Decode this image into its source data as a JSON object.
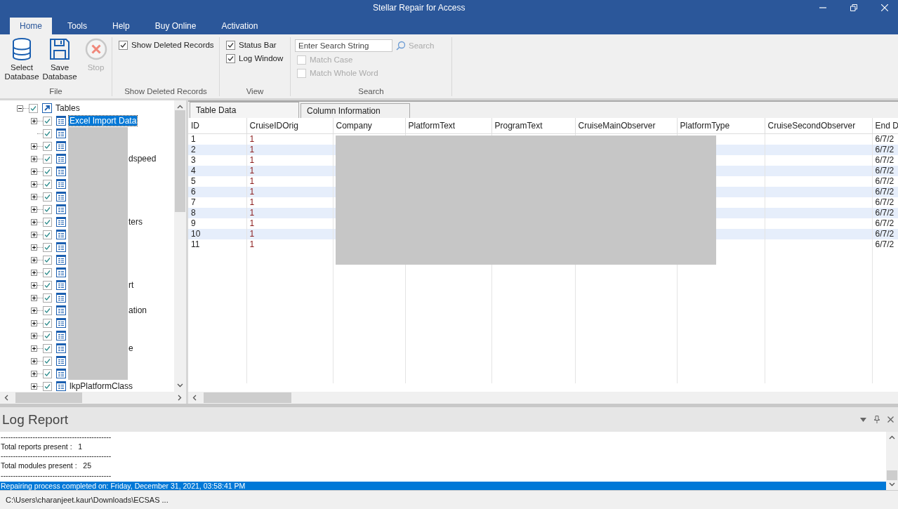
{
  "window": {
    "title": "Stellar Repair for Access"
  },
  "ribbon_tabs": [
    {
      "label": "Home",
      "selected": true
    },
    {
      "label": "Tools",
      "selected": false
    },
    {
      "label": "Help",
      "selected": false
    },
    {
      "label": "Buy Online",
      "selected": false
    },
    {
      "label": "Activation",
      "selected": false
    }
  ],
  "ribbon": {
    "file": {
      "title": "File",
      "buttons": [
        {
          "label": "Select Database",
          "disabled": false
        },
        {
          "label": "Save Database",
          "disabled": false
        },
        {
          "label": "Stop",
          "disabled": true
        }
      ]
    },
    "deleted": {
      "title": "Show Deleted Records",
      "checkboxes": [
        {
          "label": "Show Deleted Records",
          "checked": true,
          "disabled": false
        }
      ]
    },
    "view": {
      "title": "View",
      "checkboxes": [
        {
          "label": "Status Bar",
          "checked": true,
          "disabled": false
        },
        {
          "label": "Log Window",
          "checked": true,
          "disabled": false
        }
      ]
    },
    "search": {
      "title": "Search",
      "placeholder": "Enter Search String",
      "button": "Search",
      "button_disabled": true,
      "checkboxes": [
        {
          "label": "Match Case",
          "checked": false,
          "disabled": true
        },
        {
          "label": "Match Whole Word",
          "checked": false,
          "disabled": true
        }
      ]
    }
  },
  "tree": {
    "label": "Tables",
    "checked": true,
    "expanded": true,
    "children": [
      {
        "label": "Excel Import Data",
        "checked": true,
        "expandable": true,
        "redacted": false,
        "selected": true
      },
      {
        "checked": true,
        "expandable": false,
        "redacted": true,
        "selected": false
      },
      {
        "checked": true,
        "expandable": true,
        "redacted": true,
        "selected": false
      },
      {
        "label": "dspeed",
        "checked": true,
        "expandable": true,
        "redacted": true,
        "selected": false
      },
      {
        "checked": true,
        "expandable": true,
        "redacted": true,
        "selected": false
      },
      {
        "checked": true,
        "expandable": true,
        "redacted": true,
        "selected": false
      },
      {
        "checked": true,
        "expandable": true,
        "redacted": true,
        "selected": false
      },
      {
        "checked": true,
        "expandable": true,
        "redacted": true,
        "selected": false
      },
      {
        "label": "ters",
        "checked": true,
        "expandable": true,
        "redacted": true,
        "selected": false
      },
      {
        "checked": true,
        "expandable": true,
        "redacted": true,
        "selected": false
      },
      {
        "checked": true,
        "expandable": true,
        "redacted": true,
        "selected": false
      },
      {
        "checked": true,
        "expandable": true,
        "redacted": true,
        "selected": false
      },
      {
        "checked": true,
        "expandable": true,
        "redacted": true,
        "selected": false
      },
      {
        "label": "rt",
        "checked": true,
        "expandable": true,
        "redacted": true,
        "selected": false
      },
      {
        "checked": true,
        "expandable": true,
        "redacted": true,
        "selected": false
      },
      {
        "label": "ation",
        "checked": true,
        "expandable": true,
        "redacted": true,
        "selected": false
      },
      {
        "checked": true,
        "expandable": true,
        "redacted": true,
        "selected": false
      },
      {
        "checked": true,
        "expandable": true,
        "redacted": true,
        "selected": false
      },
      {
        "label": "e",
        "checked": true,
        "expandable": true,
        "redacted": true,
        "selected": false
      },
      {
        "checked": true,
        "expandable": true,
        "redacted": true,
        "selected": false
      },
      {
        "checked": true,
        "expandable": true,
        "redacted": true,
        "selected": false
      },
      {
        "label": "lkpPlatformClass",
        "checked": true,
        "expandable": true,
        "redacted": false,
        "selected": false
      }
    ]
  },
  "data_tabs": [
    {
      "label": "Table Data",
      "selected": true
    },
    {
      "label": "Column Information",
      "selected": false
    }
  ],
  "table": {
    "columns": [
      "ID",
      "CruiseIDOrig",
      "Company",
      "PlatformText",
      "ProgramText",
      "CruiseMainObserver",
      "PlatformType",
      "CruiseSecondObserver",
      "End D"
    ],
    "rows": [
      {
        "id": "1",
        "cruise_id_orig": "1",
        "end_date": "6/7/2"
      },
      {
        "id": "2",
        "cruise_id_orig": "1",
        "end_date": "6/7/2"
      },
      {
        "id": "3",
        "cruise_id_orig": "1",
        "end_date": "6/7/2"
      },
      {
        "id": "4",
        "cruise_id_orig": "1",
        "end_date": "6/7/2"
      },
      {
        "id": "5",
        "cruise_id_orig": "1",
        "end_date": "6/7/2"
      },
      {
        "id": "6",
        "cruise_id_orig": "1",
        "end_date": "6/7/2"
      },
      {
        "id": "7",
        "cruise_id_orig": "1",
        "end_date": "6/7/2"
      },
      {
        "id": "8",
        "cruise_id_orig": "1",
        "end_date": "6/7/2"
      },
      {
        "id": "9",
        "cruise_id_orig": "1",
        "end_date": "6/7/2"
      },
      {
        "id": "10",
        "cruise_id_orig": "1",
        "end_date": "6/7/2"
      },
      {
        "id": "11",
        "cruise_id_orig": "1",
        "end_date": "6/7/2"
      }
    ]
  },
  "log": {
    "title": "Log Report",
    "lines": [
      {
        "text": "---------------------------------------------",
        "selected": false
      },
      {
        "text": "Total reports present :   1",
        "selected": false
      },
      {
        "text": "---------------------------------------------",
        "selected": false
      },
      {
        "text": "Total modules present :   25",
        "selected": false
      },
      {
        "text": "---------------------------------------------",
        "selected": false
      },
      {
        "text": "Repairing process completed on: Friday, December 31, 2021, 03:58:41 PM",
        "selected": true
      }
    ]
  },
  "status_bar": {
    "path": "C:\\Users\\charanjeet.kaur\\Downloads\\ECSAS ..."
  }
}
